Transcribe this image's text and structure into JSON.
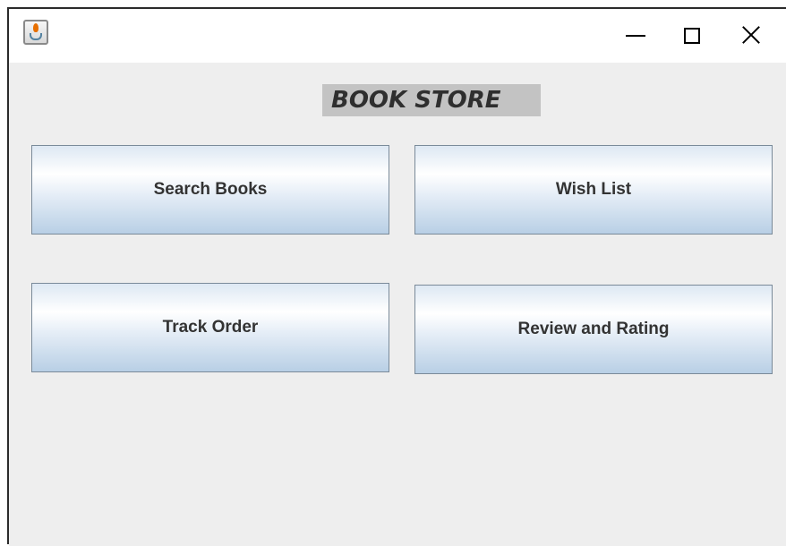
{
  "window": {
    "icon": "java-coffee-icon",
    "controls": {
      "minimize": "minimize-icon",
      "maximize": "maximize-icon",
      "close": "close-icon"
    }
  },
  "header": {
    "title": "BOOK STORE"
  },
  "buttons": {
    "search_books": "Search Books",
    "wish_list": "Wish List",
    "track_order": "Track Order",
    "review_rating": "Review and Rating"
  },
  "colors": {
    "content_background": "#eeeeee",
    "title_background": "#c3c3c3",
    "button_gradient_top": "#ffffff",
    "button_gradient_bottom": "#b8cfe5",
    "button_border": "#7a8a99"
  }
}
